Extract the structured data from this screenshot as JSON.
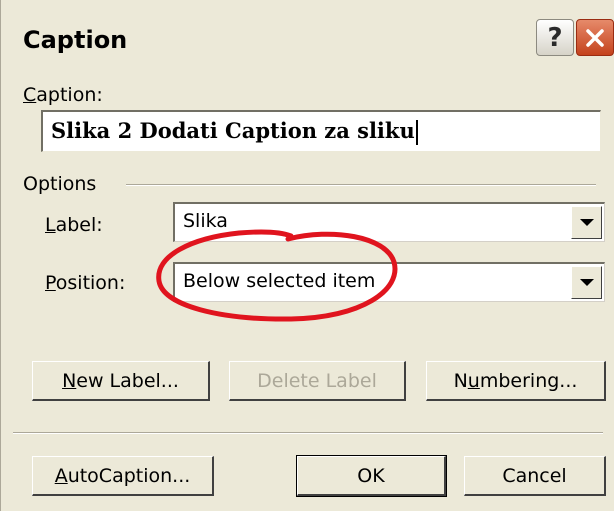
{
  "window": {
    "title": "Caption",
    "help_glyph": "?",
    "icons": {
      "help": "question-icon",
      "close": "close-icon"
    },
    "close_color": "#d44a22"
  },
  "caption_field": {
    "label_pre": "",
    "label_mnemonic": "C",
    "label_post": "aption:",
    "value": "Slika 2 Dodati Caption za sliku"
  },
  "options": {
    "group_label": "Options",
    "label_field": {
      "label_mnemonic": "L",
      "label_post": "abel:",
      "value": "Slika"
    },
    "position_field": {
      "label_mnemonic": "P",
      "label_post": "osition:",
      "value": "Below selected item"
    }
  },
  "buttons": {
    "new_label": {
      "mnemonic": "N",
      "rest": "ew Label..."
    },
    "delete_label": "Delete Label",
    "numbering": {
      "pre": "N",
      "mnemonic": "u",
      "rest": "mbering..."
    },
    "autocaption": {
      "mnemonic": "A",
      "rest": "utoCaption..."
    },
    "ok": "OK",
    "cancel": "Cancel"
  },
  "annotation": {
    "color": "#e0141e",
    "shape": "hand-drawn-circle"
  }
}
